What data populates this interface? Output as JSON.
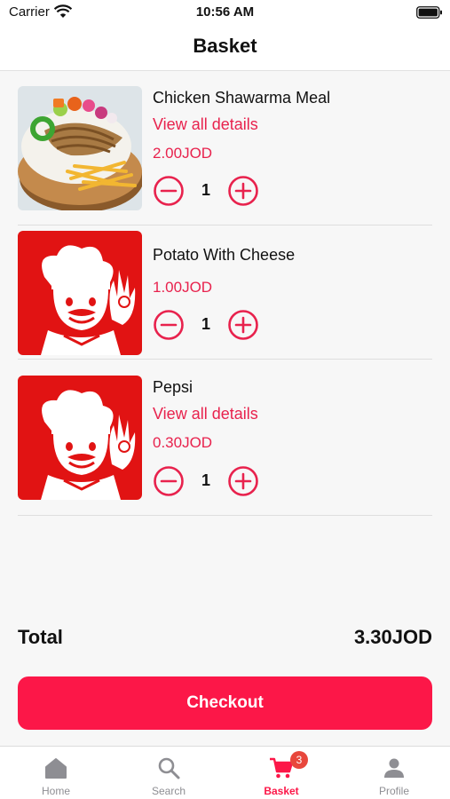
{
  "status_bar": {
    "carrier": "Carrier",
    "time": "10:56 AM"
  },
  "nav": {
    "title": "Basket"
  },
  "items": [
    {
      "name": "Chicken Shawarma Meal",
      "details_link": "View all details",
      "price": "2.00JOD",
      "quantity": "1",
      "image": "shawarma-plate"
    },
    {
      "name": "Potato With Cheese",
      "price": "1.00JOD",
      "quantity": "1",
      "image": "chef-logo"
    },
    {
      "name": "Pepsi",
      "details_link": "View all details",
      "price": "0.30JOD",
      "quantity": "1",
      "image": "chef-logo"
    }
  ],
  "summary": {
    "total_label": "Total",
    "total_value": "3.30JOD"
  },
  "checkout": {
    "label": "Checkout"
  },
  "tab_bar": {
    "tabs": [
      {
        "label": "Home",
        "icon": "home-icon"
      },
      {
        "label": "Search",
        "icon": "search-icon"
      },
      {
        "label": "Basket",
        "icon": "cart-icon",
        "badge": "3",
        "active": true
      },
      {
        "label": "Profile",
        "icon": "profile-icon"
      }
    ]
  },
  "colors": {
    "accent": "#fc1748",
    "price": "#e8224d",
    "inactive_tab": "#8e8e93",
    "badge": "#e8473c"
  }
}
